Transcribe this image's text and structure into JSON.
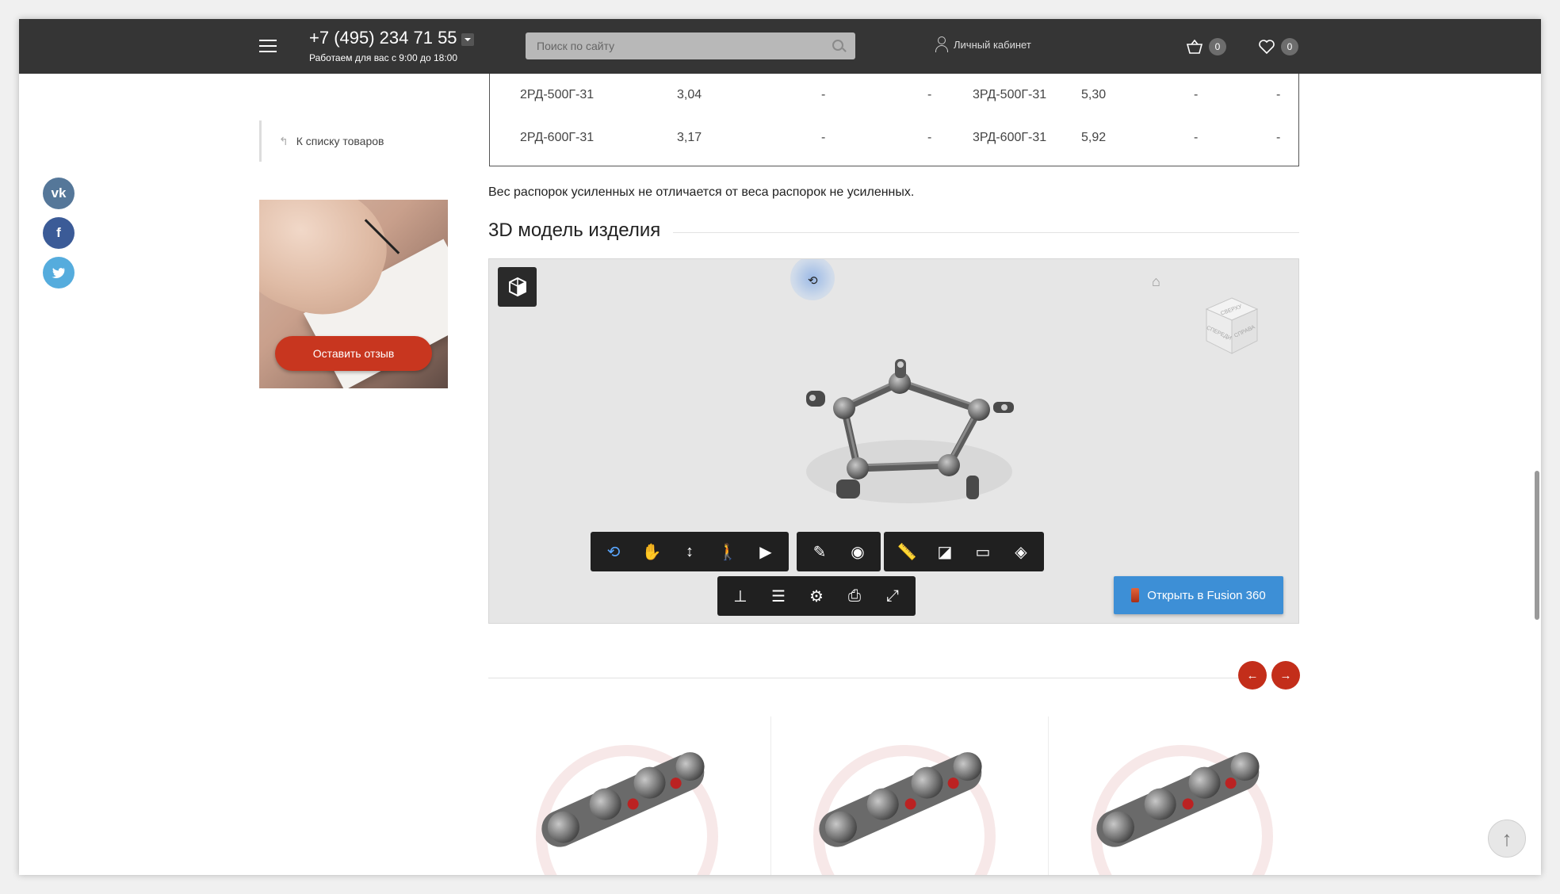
{
  "header": {
    "phone": "+7 (495) 234 71 55",
    "hours": "Работаем для вас с 9:00 до 18:00",
    "search_placeholder": "Поиск по сайту",
    "account_label": "Личный кабинет",
    "cart_count": "0",
    "favorites_count": "0"
  },
  "spec_table": {
    "rows": [
      [
        "2РД-500Г-31",
        "3,04",
        "-",
        "-",
        "3РД-500Г-31",
        "5,30",
        "-",
        "-"
      ],
      [
        "2РД-600Г-31",
        "3,17",
        "-",
        "-",
        "3РД-600Г-31",
        "5,92",
        "-",
        "-"
      ]
    ]
  },
  "weight_note": "Вес распорок усиленных не отличается от веса распорок не усиленных.",
  "back_link": "К списку товаров",
  "social": [
    "vk-icon",
    "facebook-icon",
    "twitter-icon"
  ],
  "banner": {
    "button": "Оставить отзыв"
  },
  "viewer": {
    "title": "3D модель изделия",
    "fusion_button": "Открыть в Fusion 360",
    "viewcube": {
      "top": "СВЕРХУ",
      "front": "СПЕРЕДИ",
      "right": "СПРАВА"
    }
  },
  "colors": {
    "header_bg": "#353535",
    "accent_red": "#c32e1a",
    "fusion_blue": "#3d8fd6"
  }
}
